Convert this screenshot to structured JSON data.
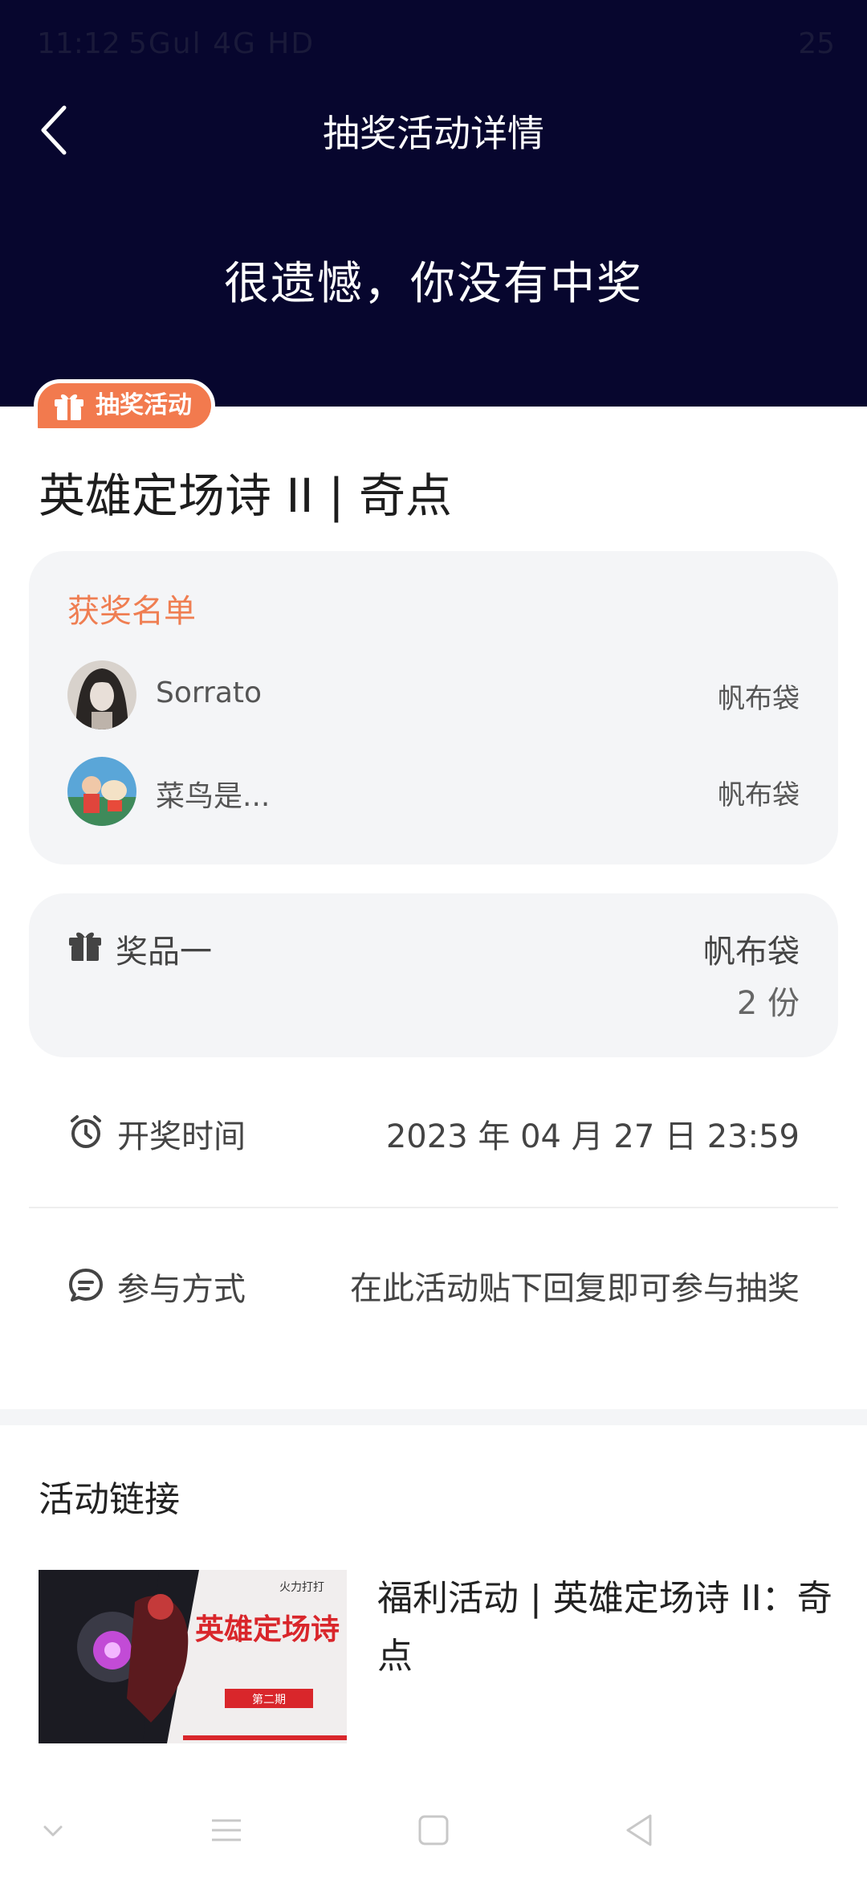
{
  "status_bar": {
    "time": "11:12",
    "network": "5Gul 4G HD",
    "battery": "25"
  },
  "header": {
    "title": "抽奖活动详情",
    "result": "很遗憾，你没有中奖"
  },
  "badge": {
    "label": "抽奖活动"
  },
  "post": {
    "title": "英雄定场诗 II | 奇点"
  },
  "winners": {
    "title": "获奖名单",
    "items": [
      {
        "name": "Sorrato",
        "prize": "帆布袋"
      },
      {
        "name": "菜鸟是...",
        "prize": "帆布袋"
      }
    ]
  },
  "prize": {
    "label": "奖品一",
    "name": "帆布袋",
    "count": "2 份"
  },
  "draw_time": {
    "label": "开奖时间",
    "value": "2023 年 04 月 27 日 23:59"
  },
  "participation": {
    "label": "参与方式",
    "value": "在此活动贴下回复即可参与抽奖"
  },
  "links": {
    "title": "活动链接",
    "item": {
      "text": "福利活动 | 英雄定场诗 II：奇点",
      "thumb_title": "英雄定场诗",
      "thumb_sub": "第二期",
      "thumb_brand": "火力打打"
    }
  },
  "colors": {
    "header_bg": "#07062e",
    "accent": "#f27a4e",
    "card_bg": "#f4f5f7"
  }
}
